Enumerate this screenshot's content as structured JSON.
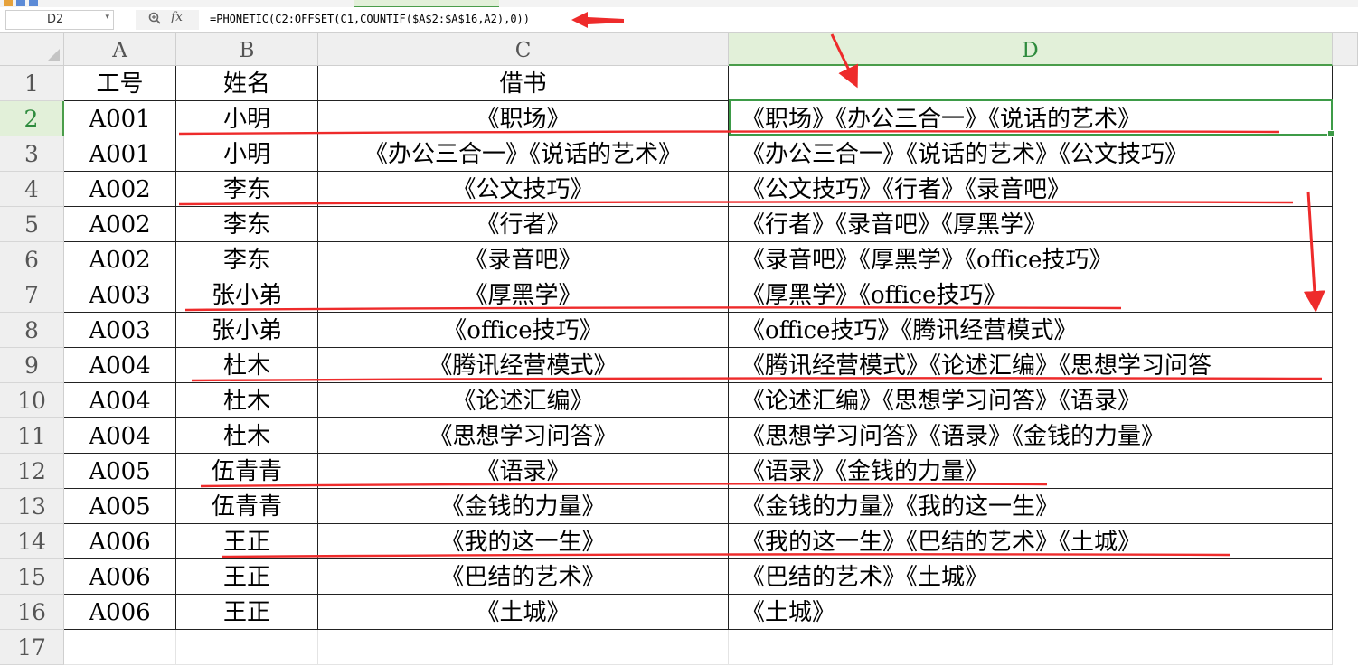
{
  "formula_bar": {
    "name_box": "D2",
    "fx_label": "fx",
    "formula": "=PHONETIC(C2:OFFSET(C1,COUNTIF($A$2:$A$16,A2),0))"
  },
  "columns": [
    "A",
    "B",
    "C",
    "D"
  ],
  "row_numbers": [
    "1",
    "2",
    "3",
    "4",
    "5",
    "6",
    "7",
    "8",
    "9",
    "10",
    "11",
    "12",
    "13",
    "14",
    "15",
    "16",
    "17"
  ],
  "headers": [
    "工号",
    "姓名",
    "借书",
    ""
  ],
  "rows": [
    {
      "a": "A001",
      "b": "小明",
      "c": "《职场》",
      "d": "《职场》《办公三合一》《说话的艺术》"
    },
    {
      "a": "A001",
      "b": "小明",
      "c": "《办公三合一》《说话的艺术》",
      "d": "《办公三合一》《说话的艺术》《公文技巧》"
    },
    {
      "a": "A002",
      "b": "李东",
      "c": "《公文技巧》",
      "d": "《公文技巧》《行者》《录音吧》"
    },
    {
      "a": "A002",
      "b": "李东",
      "c": "《行者》",
      "d": "《行者》《录音吧》《厚黑学》"
    },
    {
      "a": "A002",
      "b": "李东",
      "c": "《录音吧》",
      "d": "《录音吧》《厚黑学》《office技巧》"
    },
    {
      "a": "A003",
      "b": "张小弟",
      "c": "《厚黑学》",
      "d": "《厚黑学》《office技巧》"
    },
    {
      "a": "A003",
      "b": "张小弟",
      "c": "《office技巧》",
      "d": "《office技巧》《腾讯经营模式》"
    },
    {
      "a": "A004",
      "b": "杜木",
      "c": "《腾讯经营模式》",
      "d": "《腾讯经营模式》《论述汇编》《思想学习问答"
    },
    {
      "a": "A004",
      "b": "杜木",
      "c": "《论述汇编》",
      "d": "《论述汇编》《思想学习问答》《语录》"
    },
    {
      "a": "A004",
      "b": "杜木",
      "c": "《思想学习问答》",
      "d": "《思想学习问答》《语录》《金钱的力量》"
    },
    {
      "a": "A005",
      "b": "伍青青",
      "c": "《语录》",
      "d": "《语录》《金钱的力量》"
    },
    {
      "a": "A005",
      "b": "伍青青",
      "c": "《金钱的力量》",
      "d": "《金钱的力量》《我的这一生》"
    },
    {
      "a": "A006",
      "b": "王正",
      "c": "《我的这一生》",
      "d": "《我的这一生》《巴结的艺术》《土城》"
    },
    {
      "a": "A006",
      "b": "王正",
      "c": "《巴结的艺术》",
      "d": "《巴结的艺术》《土城》"
    },
    {
      "a": "A006",
      "b": "王正",
      "c": "《土城》",
      "d": "《土城》"
    }
  ],
  "colors": {
    "annotation_red": "#ee2b2b",
    "selection_green": "#3d9b47",
    "header_gray": "#efefef"
  }
}
